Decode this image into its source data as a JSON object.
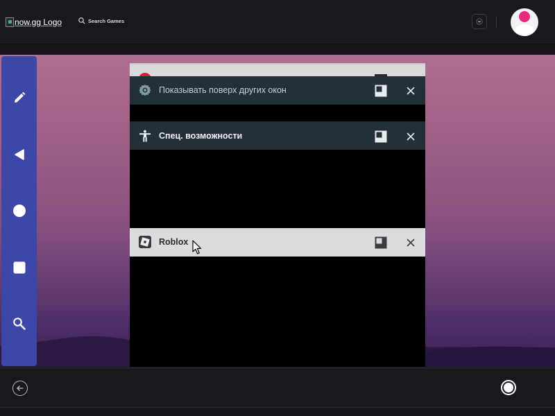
{
  "header": {
    "logo_alt": "now.gg Logo",
    "search_label": "Search Games"
  },
  "sidebar": {
    "items": [
      {
        "icon": "pencil-icon"
      },
      {
        "icon": "back-triangle-icon"
      },
      {
        "icon": "home-circle-icon"
      },
      {
        "icon": "recents-square-icon"
      },
      {
        "icon": "search-icon"
      }
    ]
  },
  "windows": {
    "overlay": {
      "title": "Показывать поверх других окон",
      "icon": "settings-gear-icon"
    },
    "accessibility": {
      "title": "Спец. возможности",
      "icon": "accessibility-icon"
    },
    "roblox": {
      "title": "Roblox",
      "icon": "roblox-icon"
    }
  },
  "colors": {
    "sidebar": "#3c47a8",
    "window_header_dark": "#243038",
    "window_header_light": "#dcdcde",
    "avatar_accent": "#ec2a7e"
  }
}
